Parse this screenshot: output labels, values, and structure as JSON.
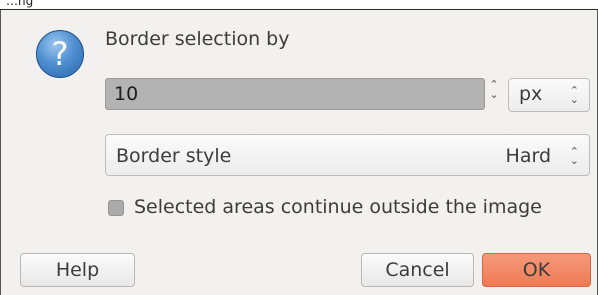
{
  "window": {
    "title_fragment": "…ng"
  },
  "dialog": {
    "icon": "question-icon",
    "heading": "Border selection by",
    "size": {
      "value": "10",
      "unit": "px"
    },
    "border_style": {
      "label": "Border style",
      "value": "Hard"
    },
    "outside_image": {
      "label": "Selected areas continue outside the image",
      "checked": false
    }
  },
  "buttons": {
    "help": "Help",
    "cancel": "Cancel",
    "ok": "OK"
  },
  "colors": {
    "ok_button": "#ef7a55",
    "icon_blue": "#4f8fd0",
    "input_bg": "#b3b3b3"
  },
  "symbols": {
    "question_mark": "?",
    "arrow_up": "⌃",
    "arrow_down": "⌄"
  }
}
